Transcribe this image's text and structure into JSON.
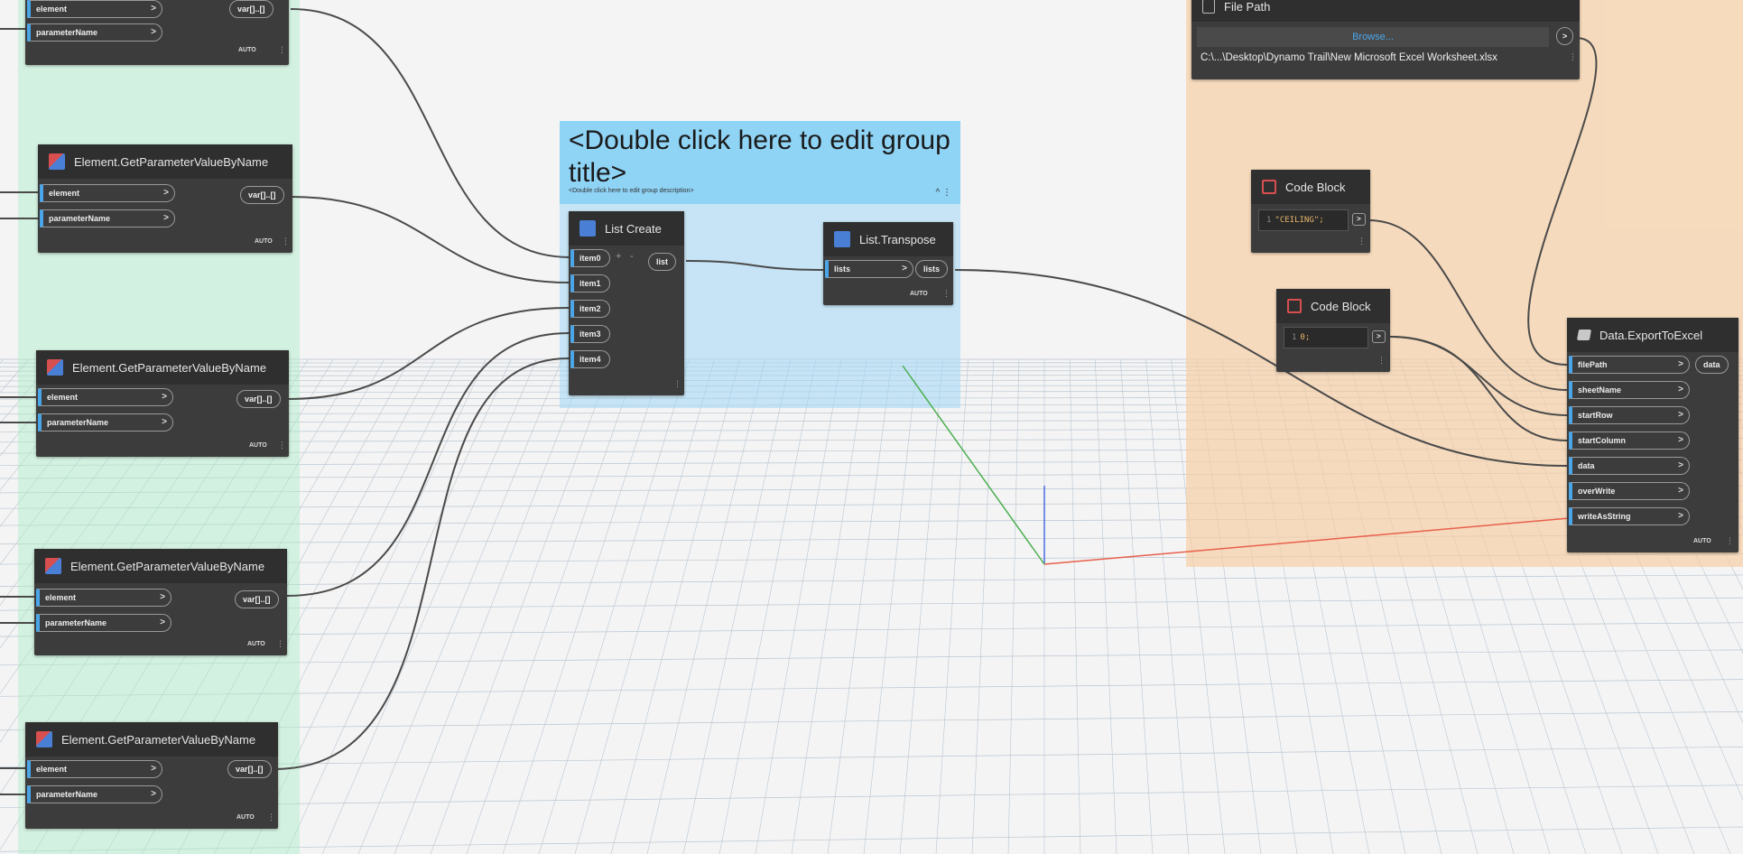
{
  "canvas": {
    "background": "#f4f4f4",
    "grid_line_color": "#b9c6d2"
  },
  "groups": {
    "blue": {
      "title": "<Double click here to edit group title>",
      "description": "<Double click here to edit group description>",
      "color": "#8fd3f5"
    },
    "green": {
      "color": "#aaeec8"
    },
    "orange": {
      "color": "#f8cda0"
    }
  },
  "nodes": {
    "get_param_0": {
      "inputs": [
        "element",
        "parameterName"
      ],
      "output": "var[]..[]",
      "lacing": "AUTO"
    },
    "get_param_1": {
      "title": "Element.GetParameterValueByName",
      "icon": "revit-icon",
      "inputs": [
        "element",
        "parameterName"
      ],
      "output": "var[]..[]",
      "lacing": "AUTO"
    },
    "get_param_2": {
      "title": "Element.GetParameterValueByName",
      "icon": "revit-icon",
      "inputs": [
        "element",
        "parameterName"
      ],
      "output": "var[]..[]",
      "lacing": "AUTO"
    },
    "get_param_3": {
      "title": "Element.GetParameterValueByName",
      "icon": "revit-icon",
      "inputs": [
        "element",
        "parameterName"
      ],
      "output": "var[]..[]",
      "lacing": "AUTO"
    },
    "get_param_4": {
      "title": "Element.GetParameterValueByName",
      "icon": "revit-icon",
      "inputs": [
        "element",
        "parameterName"
      ],
      "output": "var[]..[]",
      "lacing": "AUTO"
    },
    "list_create": {
      "title": "List Create",
      "icon": "list-icon",
      "inputs": [
        "item0",
        "item1",
        "item2",
        "item3",
        "item4"
      ],
      "output": "list",
      "add": "+",
      "remove": "-"
    },
    "list_transpose": {
      "title": "List.Transpose",
      "icon": "list-icon",
      "inputs": [
        "lists"
      ],
      "output": "lists",
      "lacing": "AUTO"
    },
    "file_path": {
      "title": "File Path",
      "icon": "file-icon",
      "browse": "Browse...",
      "path": "C:\\...\\Desktop\\Dynamo Trail\\New Microsoft Excel Worksheet.xlsx",
      "output": ">"
    },
    "code_block_1": {
      "title": "Code Block",
      "icon": "code-block-icon",
      "line_no": "1",
      "code": "\"CEILING\";",
      "output": ">"
    },
    "code_block_2": {
      "title": "Code Block",
      "icon": "code-block-icon",
      "line_no": "1",
      "code": "0;",
      "output": ">"
    },
    "export_excel": {
      "title": "Data.ExportToExcel",
      "icon": "export-icon",
      "inputs": [
        "filePath",
        "sheetName",
        "startRow",
        "startColumn",
        "data",
        "overWrite",
        "writeAsString"
      ],
      "output": "data",
      "lacing": "AUTO"
    }
  }
}
